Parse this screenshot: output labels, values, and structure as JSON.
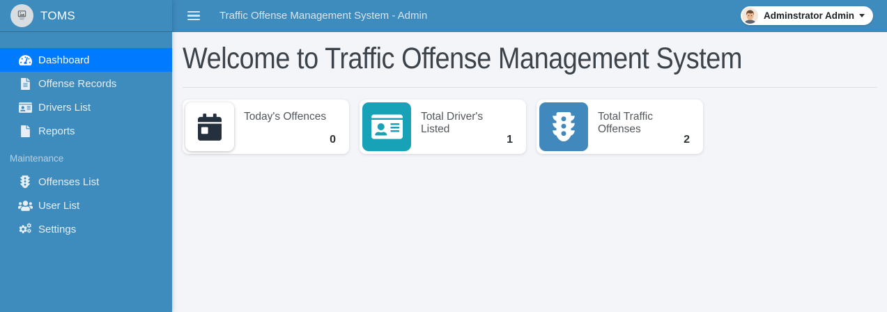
{
  "brand": {
    "name": "TOMS",
    "logo": "broken-image-placeholder-icon"
  },
  "navbar": {
    "title": "Traffic Offense Management System - Admin",
    "menu_icon": "hamburger-icon",
    "user": {
      "name": "Adminstrator Admin",
      "avatar_icon": "male-avatar-icon",
      "caret_icon": "caret-down-icon"
    }
  },
  "sidebar": {
    "items": [
      {
        "label": "Dashboard",
        "icon": "tachometer-icon",
        "active": true
      },
      {
        "label": "Offense Records",
        "icon": "file-alt-icon",
        "active": false
      },
      {
        "label": "Drivers List",
        "icon": "id-card-icon",
        "active": false
      },
      {
        "label": "Reports",
        "icon": "file-icon",
        "active": false
      }
    ],
    "section_header": "Maintenance",
    "maintenance_items": [
      {
        "label": "Offenses List",
        "icon": "traffic-light-icon",
        "active": false
      },
      {
        "label": "User List",
        "icon": "users-icon",
        "active": false
      },
      {
        "label": "Settings",
        "icon": "cogs-icon",
        "active": false
      }
    ]
  },
  "main": {
    "heading": "Welcome to Traffic Offense Management System",
    "cards": [
      {
        "title": "Today's Offences",
        "value": "0",
        "icon": "calendar-day-icon",
        "tile_color": "#ffffff",
        "icon_color": "#24303e"
      },
      {
        "title": "Total Driver's Listed",
        "value": "1",
        "icon": "id-card-icon",
        "tile_color": "#18a2b8",
        "icon_color": "#ffffff"
      },
      {
        "title": "Total Traffic Offenses",
        "value": "2",
        "icon": "traffic-light-icon",
        "tile_color": "#4189bd",
        "icon_color": "#ffffff"
      }
    ]
  },
  "colors": {
    "sidebar_navbar": "#3e8bbe",
    "active_item": "#007bff",
    "content_background": "#f3f5f9",
    "teal_tile": "#18a2b8",
    "blue_tile": "#4189bd",
    "heading_text": "#3c434b"
  }
}
